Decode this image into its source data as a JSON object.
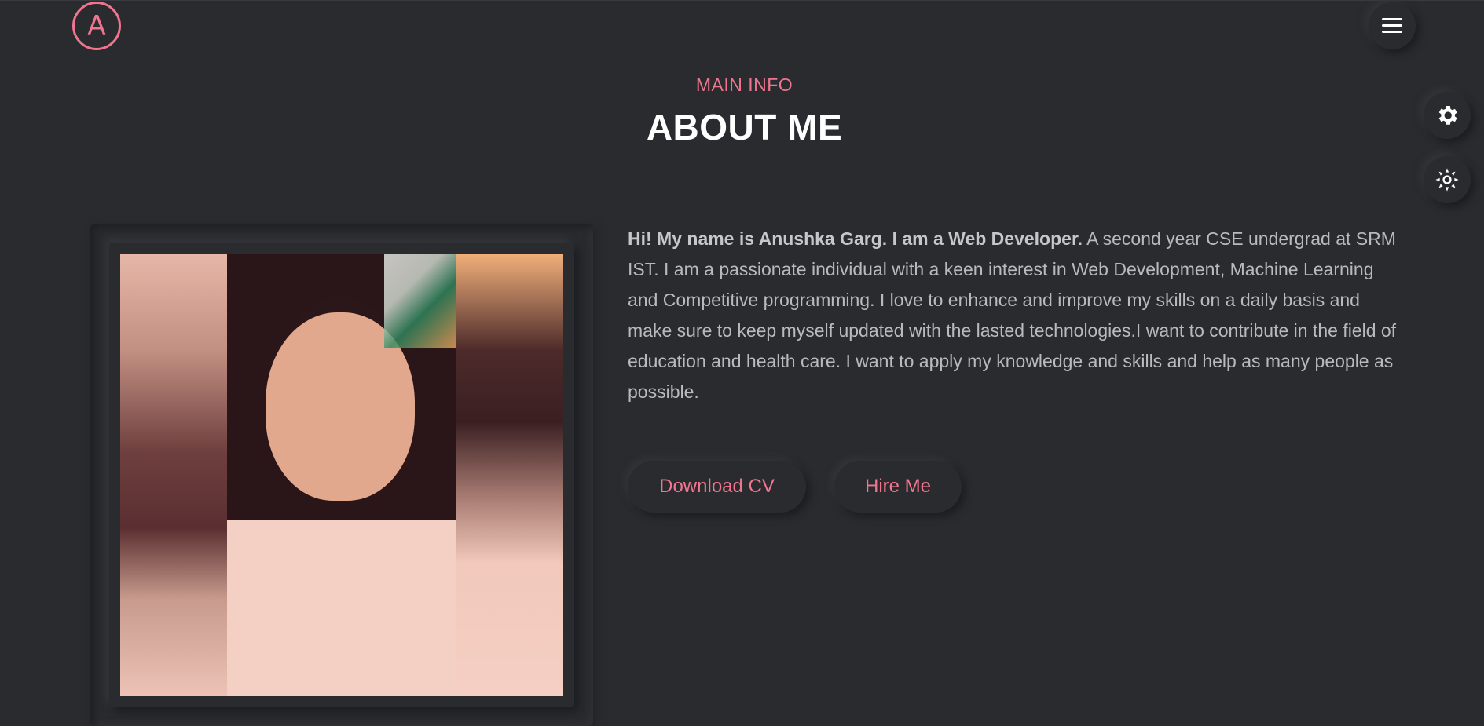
{
  "header": {
    "logo_letter": "A",
    "menu_icon": "hamburger-menu-icon"
  },
  "side_controls": {
    "settings_icon": "gear-icon",
    "theme_icon": "sun-icon"
  },
  "section": {
    "subtitle": "MAIN INFO",
    "title": "ABOUT ME"
  },
  "about": {
    "intro_strong": "Hi! My name is Anushka Garg. I am a Web Developer.",
    "intro_text": " A second year CSE undergrad at SRM IST. I am a passionate individual with a keen interest in Web Development, Machine Learning and Competitive programming. I love to enhance and improve my skills on a daily basis and make sure to keep myself updated with the lasted technologies.I want to contribute in the field of education and health care. I want to apply my knowledge and skills and help as many people as possible."
  },
  "buttons": {
    "download_cv": "Download CV",
    "hire_me": "Hire Me"
  },
  "colors": {
    "background": "#2a2b2f",
    "accent": "#f0758f",
    "text": "#b9babf"
  }
}
